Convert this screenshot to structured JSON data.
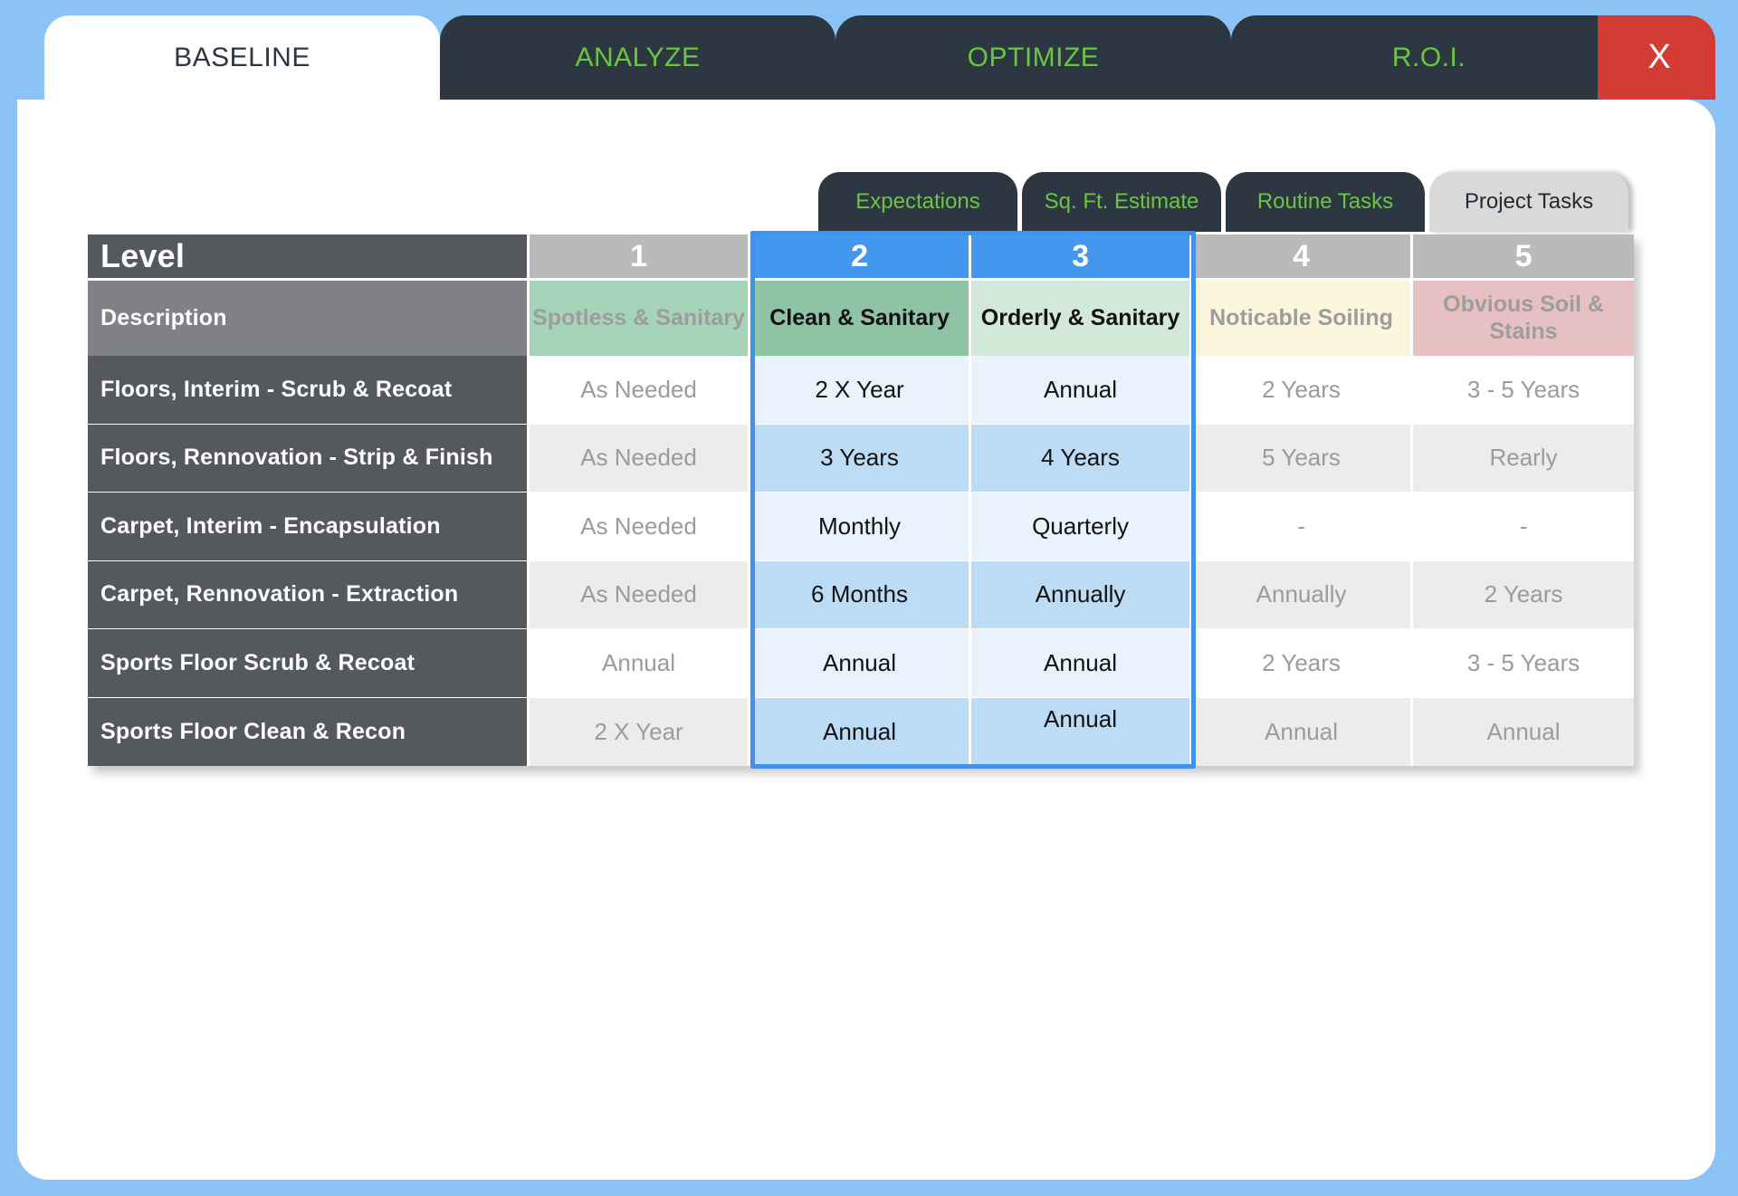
{
  "top_tabs": [
    {
      "label": "BASELINE",
      "active": true
    },
    {
      "label": "ANALYZE",
      "active": false
    },
    {
      "label": "OPTIMIZE",
      "active": false
    },
    {
      "label": "R.O.I.",
      "active": false
    }
  ],
  "close_label": "X",
  "sub_tabs": [
    {
      "label": "Expectations",
      "active": false
    },
    {
      "label": "Sq. Ft. Estimate",
      "active": false
    },
    {
      "label": "Routine Tasks",
      "active": false
    },
    {
      "label": "Project Tasks",
      "active": true
    }
  ],
  "table": {
    "level_label": "Level",
    "levels": [
      "1",
      "2",
      "3",
      "4",
      "5"
    ],
    "selected_levels": [
      "2",
      "3"
    ],
    "description_label": "Description",
    "descriptions": [
      "Spotless & Sanitary",
      "Clean & Sanitary",
      "Orderly & Sanitary",
      "Noticable Soiling",
      "Obvious Soil & Stains"
    ],
    "rows": [
      {
        "task": "Floors, Interim - Scrub & Recoat",
        "values": [
          "As Needed",
          "2 X Year",
          "Annual",
          "2 Years",
          "3 - 5 Years"
        ]
      },
      {
        "task": "Floors, Rennovation - Strip & Finish",
        "values": [
          "As Needed",
          "3 Years",
          "4 Years",
          "5 Years",
          "Rearly"
        ]
      },
      {
        "task": "Carpet, Interim - Encapsulation",
        "values": [
          "As Needed",
          "Monthly",
          "Quarterly",
          "-",
          "-"
        ]
      },
      {
        "task": "Carpet, Rennovation - Extraction",
        "values": [
          "As Needed",
          "6 Months",
          "Annually",
          "Annually",
          "2 Years"
        ]
      },
      {
        "task": "Sports Floor Scrub & Recoat",
        "values": [
          "Annual",
          "Annual",
          "Annual",
          "2 Years",
          "3 - 5 Years"
        ]
      },
      {
        "task": "Sports Floor Clean & Recon",
        "values": [
          "2 X Year",
          "Annual",
          "Annual",
          "Annual",
          "Annual"
        ]
      }
    ]
  },
  "colors": {
    "background": "#8cc3f6",
    "tab_dark": "#2d3741",
    "tab_text": "#6cc542",
    "close": "#d33b33",
    "selection": "#3f93ef"
  }
}
